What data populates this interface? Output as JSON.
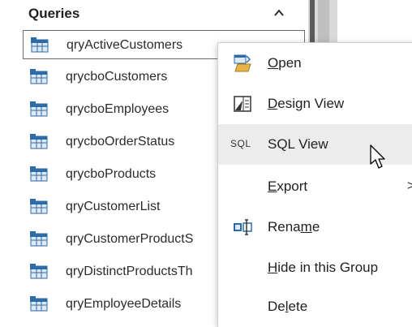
{
  "nav": {
    "title": "Queries",
    "items": [
      {
        "label": "qryActiveCustomers",
        "selected": true
      },
      {
        "label": "qrycboCustomers"
      },
      {
        "label": "qrycboEmployees"
      },
      {
        "label": "qrycboOrderStatus"
      },
      {
        "label": "qrycboProducts"
      },
      {
        "label": "qryCustomerList"
      },
      {
        "label": "qryCustomerProductS"
      },
      {
        "label": "qryDistinctProductsTh"
      },
      {
        "label": "qryEmployeeDetails"
      }
    ]
  },
  "menu": {
    "open": {
      "pre": "",
      "key": "O",
      "post": "pen"
    },
    "design": {
      "pre": "",
      "key": "D",
      "post": "esign View"
    },
    "sql_icon": "SQL",
    "sql": {
      "pre": "SQL View",
      "key": "",
      "post": ""
    },
    "export": {
      "pre": "",
      "key": "E",
      "post": "xport"
    },
    "export_arrow": ">",
    "rename": {
      "pre": "Rena",
      "key": "m",
      "post": "e"
    },
    "hide": {
      "pre": "",
      "key": "H",
      "post": "ide in this Group"
    },
    "delete": {
      "pre": "De",
      "key": "l",
      "post": "ete"
    }
  },
  "colors": {
    "selected_border": "#6b6b6b",
    "hover_bg": "#ececec",
    "scroll_track": "#5a5a5a"
  }
}
